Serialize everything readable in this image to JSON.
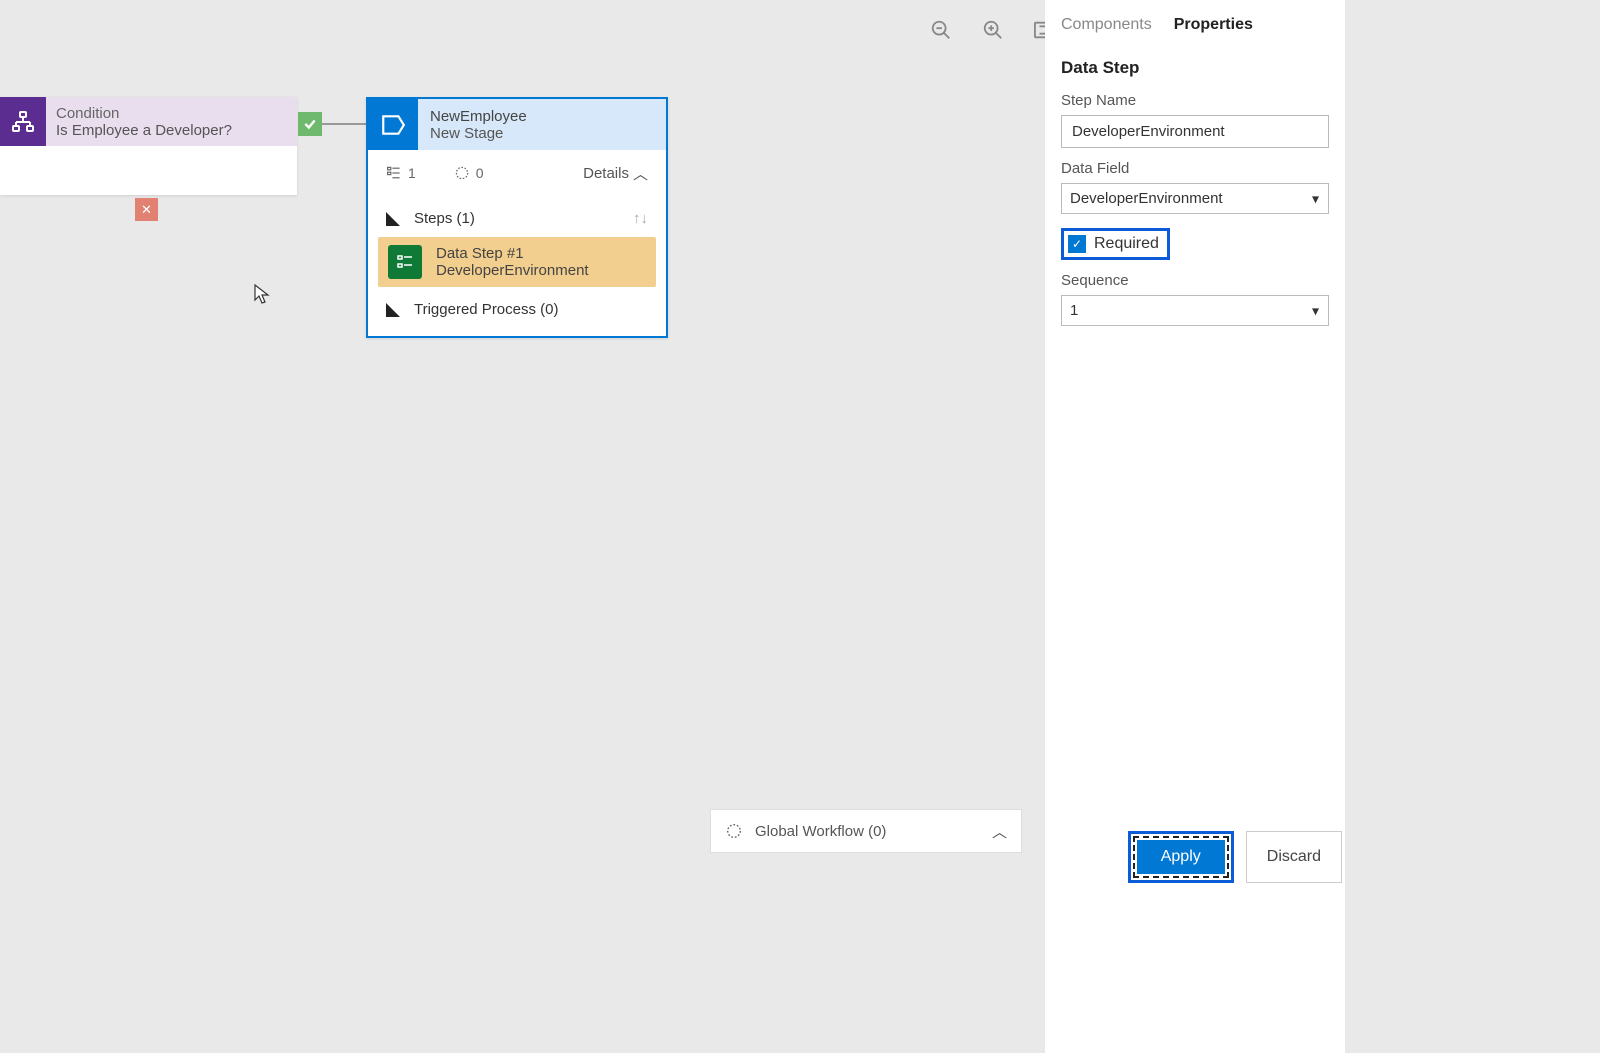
{
  "canvas": {
    "condition": {
      "type_label": "Condition",
      "name": "Is Employee a Developer?"
    },
    "stage": {
      "type_label": "NewEmployee",
      "name": "New Stage",
      "stat1": "1",
      "stat2": "0",
      "details_label": "Details",
      "steps_label": "Steps (1)",
      "data_step_title": "Data Step #1",
      "data_step_name": "DeveloperEnvironment",
      "triggered_label": "Triggered Process (0)"
    },
    "global_workflow_label": "Global Workflow (0)"
  },
  "panel": {
    "tabs": {
      "components": "Components",
      "properties": "Properties"
    },
    "section_title": "Data Step",
    "step_name_label": "Step Name",
    "step_name_value": "DeveloperEnvironment",
    "data_field_label": "Data Field",
    "data_field_value": "DeveloperEnvironment",
    "required_label": "Required",
    "sequence_label": "Sequence",
    "sequence_value": "1",
    "apply_label": "Apply",
    "discard_label": "Discard"
  }
}
